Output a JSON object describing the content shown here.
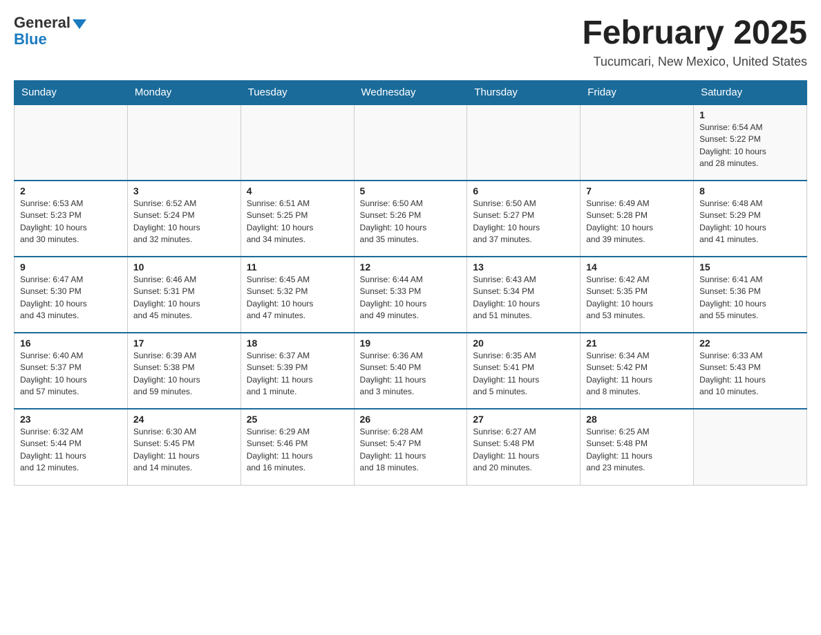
{
  "header": {
    "logo_general": "General",
    "logo_blue": "Blue",
    "title": "February 2025",
    "subtitle": "Tucumcari, New Mexico, United States"
  },
  "days_of_week": [
    "Sunday",
    "Monday",
    "Tuesday",
    "Wednesday",
    "Thursday",
    "Friday",
    "Saturday"
  ],
  "weeks": [
    [
      {
        "day": "",
        "info": ""
      },
      {
        "day": "",
        "info": ""
      },
      {
        "day": "",
        "info": ""
      },
      {
        "day": "",
        "info": ""
      },
      {
        "day": "",
        "info": ""
      },
      {
        "day": "",
        "info": ""
      },
      {
        "day": "1",
        "info": "Sunrise: 6:54 AM\nSunset: 5:22 PM\nDaylight: 10 hours\nand 28 minutes."
      }
    ],
    [
      {
        "day": "2",
        "info": "Sunrise: 6:53 AM\nSunset: 5:23 PM\nDaylight: 10 hours\nand 30 minutes."
      },
      {
        "day": "3",
        "info": "Sunrise: 6:52 AM\nSunset: 5:24 PM\nDaylight: 10 hours\nand 32 minutes."
      },
      {
        "day": "4",
        "info": "Sunrise: 6:51 AM\nSunset: 5:25 PM\nDaylight: 10 hours\nand 34 minutes."
      },
      {
        "day": "5",
        "info": "Sunrise: 6:50 AM\nSunset: 5:26 PM\nDaylight: 10 hours\nand 35 minutes."
      },
      {
        "day": "6",
        "info": "Sunrise: 6:50 AM\nSunset: 5:27 PM\nDaylight: 10 hours\nand 37 minutes."
      },
      {
        "day": "7",
        "info": "Sunrise: 6:49 AM\nSunset: 5:28 PM\nDaylight: 10 hours\nand 39 minutes."
      },
      {
        "day": "8",
        "info": "Sunrise: 6:48 AM\nSunset: 5:29 PM\nDaylight: 10 hours\nand 41 minutes."
      }
    ],
    [
      {
        "day": "9",
        "info": "Sunrise: 6:47 AM\nSunset: 5:30 PM\nDaylight: 10 hours\nand 43 minutes."
      },
      {
        "day": "10",
        "info": "Sunrise: 6:46 AM\nSunset: 5:31 PM\nDaylight: 10 hours\nand 45 minutes."
      },
      {
        "day": "11",
        "info": "Sunrise: 6:45 AM\nSunset: 5:32 PM\nDaylight: 10 hours\nand 47 minutes."
      },
      {
        "day": "12",
        "info": "Sunrise: 6:44 AM\nSunset: 5:33 PM\nDaylight: 10 hours\nand 49 minutes."
      },
      {
        "day": "13",
        "info": "Sunrise: 6:43 AM\nSunset: 5:34 PM\nDaylight: 10 hours\nand 51 minutes."
      },
      {
        "day": "14",
        "info": "Sunrise: 6:42 AM\nSunset: 5:35 PM\nDaylight: 10 hours\nand 53 minutes."
      },
      {
        "day": "15",
        "info": "Sunrise: 6:41 AM\nSunset: 5:36 PM\nDaylight: 10 hours\nand 55 minutes."
      }
    ],
    [
      {
        "day": "16",
        "info": "Sunrise: 6:40 AM\nSunset: 5:37 PM\nDaylight: 10 hours\nand 57 minutes."
      },
      {
        "day": "17",
        "info": "Sunrise: 6:39 AM\nSunset: 5:38 PM\nDaylight: 10 hours\nand 59 minutes."
      },
      {
        "day": "18",
        "info": "Sunrise: 6:37 AM\nSunset: 5:39 PM\nDaylight: 11 hours\nand 1 minute."
      },
      {
        "day": "19",
        "info": "Sunrise: 6:36 AM\nSunset: 5:40 PM\nDaylight: 11 hours\nand 3 minutes."
      },
      {
        "day": "20",
        "info": "Sunrise: 6:35 AM\nSunset: 5:41 PM\nDaylight: 11 hours\nand 5 minutes."
      },
      {
        "day": "21",
        "info": "Sunrise: 6:34 AM\nSunset: 5:42 PM\nDaylight: 11 hours\nand 8 minutes."
      },
      {
        "day": "22",
        "info": "Sunrise: 6:33 AM\nSunset: 5:43 PM\nDaylight: 11 hours\nand 10 minutes."
      }
    ],
    [
      {
        "day": "23",
        "info": "Sunrise: 6:32 AM\nSunset: 5:44 PM\nDaylight: 11 hours\nand 12 minutes."
      },
      {
        "day": "24",
        "info": "Sunrise: 6:30 AM\nSunset: 5:45 PM\nDaylight: 11 hours\nand 14 minutes."
      },
      {
        "day": "25",
        "info": "Sunrise: 6:29 AM\nSunset: 5:46 PM\nDaylight: 11 hours\nand 16 minutes."
      },
      {
        "day": "26",
        "info": "Sunrise: 6:28 AM\nSunset: 5:47 PM\nDaylight: 11 hours\nand 18 minutes."
      },
      {
        "day": "27",
        "info": "Sunrise: 6:27 AM\nSunset: 5:48 PM\nDaylight: 11 hours\nand 20 minutes."
      },
      {
        "day": "28",
        "info": "Sunrise: 6:25 AM\nSunset: 5:48 PM\nDaylight: 11 hours\nand 23 minutes."
      },
      {
        "day": "",
        "info": ""
      }
    ]
  ]
}
